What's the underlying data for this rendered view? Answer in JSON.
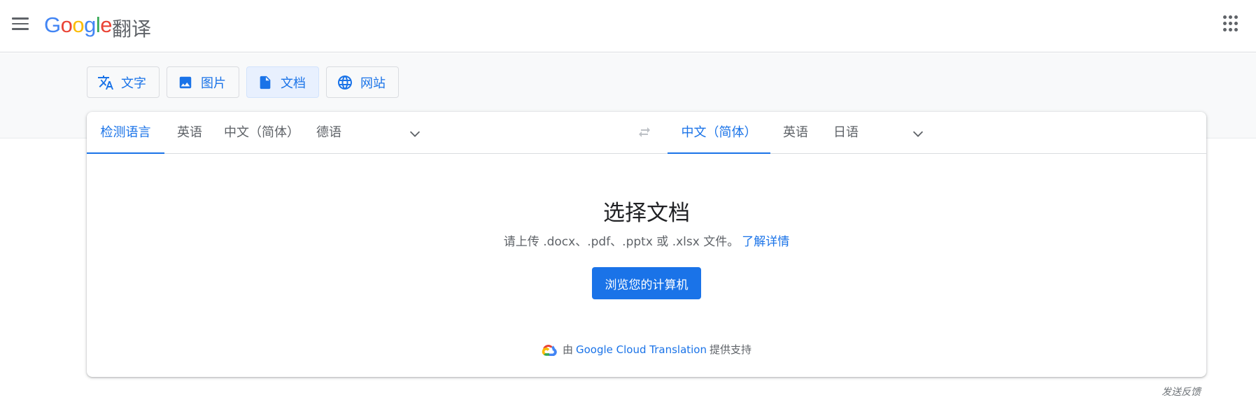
{
  "header": {
    "logo": {
      "G": "G",
      "o1": "o",
      "o2": "o",
      "g": "g",
      "l": "l",
      "e": "e"
    },
    "product_name": "翻译"
  },
  "mode_tabs": [
    {
      "label": "文字",
      "icon": "translate-icon"
    },
    {
      "label": "图片",
      "icon": "image-icon"
    },
    {
      "label": "文档",
      "icon": "document-icon",
      "active": true
    },
    {
      "label": "网站",
      "icon": "globe-icon"
    }
  ],
  "source_langs": [
    {
      "label": "检测语言",
      "active": true
    },
    {
      "label": "英语"
    },
    {
      "label": "中文（简体）"
    },
    {
      "label": "德语"
    }
  ],
  "target_langs": [
    {
      "label": "中文（简体）",
      "active": true
    },
    {
      "label": "英语"
    },
    {
      "label": "日语"
    }
  ],
  "document": {
    "title": "选择文档",
    "subtitle": "请上传 .docx、.pdf、.pptx 或 .xlsx 文件。",
    "learn_more": "了解详情",
    "browse_button": "浏览您的计算机"
  },
  "powered_by": {
    "prefix": "由",
    "link": "Google Cloud Translation",
    "suffix": "提供支持"
  },
  "feedback": "发送反馈",
  "colors": {
    "accent": "#1a73e8",
    "active_tab_bg": "#e8f0fe",
    "band_bg": "#f8f9fa"
  }
}
